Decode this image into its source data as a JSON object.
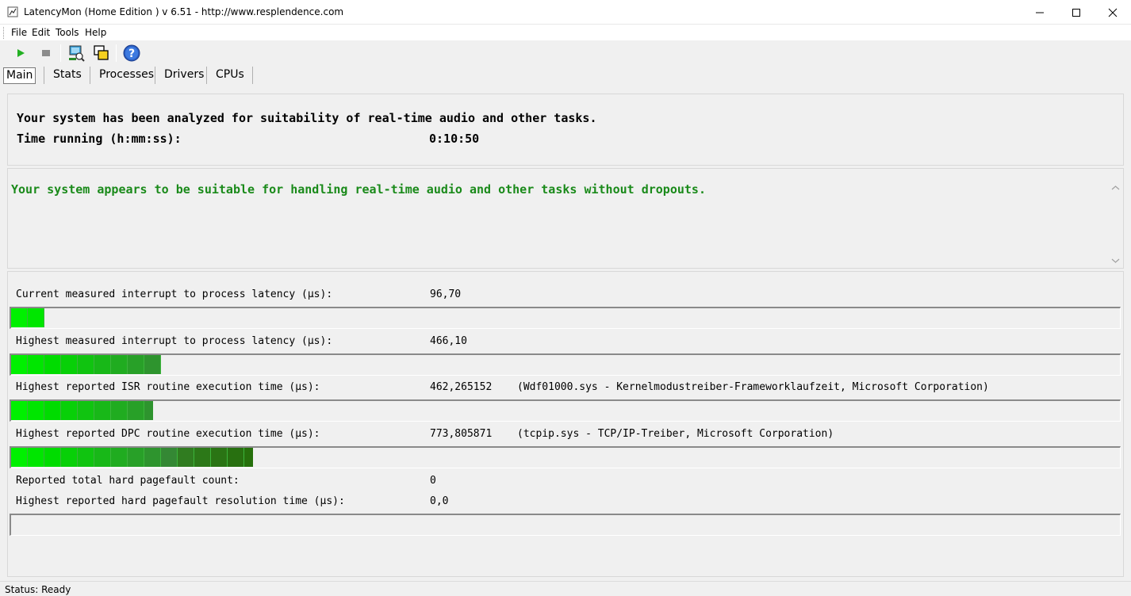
{
  "window": {
    "title": "LatencyMon  (Home Edition )  v 6.51 - http://www.resplendence.com",
    "controls": [
      "minimize-icon",
      "maximize-icon",
      "close-icon"
    ]
  },
  "menu": {
    "items": [
      "File",
      "Edit",
      "Tools",
      "Help"
    ]
  },
  "toolbar": {
    "buttons": [
      "play-icon",
      "stop-icon",
      "monitor-icon",
      "windows-icon",
      "help-icon"
    ]
  },
  "tabs": [
    "Main",
    "Stats",
    "Processes",
    "Drivers",
    "CPUs"
  ],
  "summary": {
    "analyzed": "Your system has been analyzed for suitability of real-time audio and other tasks.",
    "time_label": "Time running (h:mm:ss):",
    "time_value": "0:10:50"
  },
  "verdict": {
    "text": "Your system appears to be suitable for handling real-time audio and other tasks without dropouts.",
    "color": "#1a8a1a"
  },
  "metrics": [
    {
      "label": "Current measured interrupt to process latency (µs):",
      "value": "96,70",
      "extra": "",
      "bar_segments": 2
    },
    {
      "label": "Highest measured interrupt to process latency (µs):",
      "value": "466,10",
      "extra": "",
      "bar_segments": 9
    },
    {
      "label": "Highest reported ISR routine execution time (µs):",
      "value": "462,265152",
      "extra": "(Wdf01000.sys - Kernelmodustreiber-Frameworklaufzeit, Microsoft Corporation)",
      "bar_segments": 8.5
    },
    {
      "label": "Highest reported DPC routine execution time (µs):",
      "value": "773,805871",
      "extra": "(tcpip.sys - TCP/IP-Treiber, Microsoft Corporation)",
      "bar_segments": 14.5
    },
    {
      "label": "Reported total hard pagefault count:",
      "value": "0",
      "extra": ""
    },
    {
      "label": "Highest reported hard pagefault resolution time (µs):",
      "value": "0,0",
      "extra": "",
      "bar_segments": 0
    }
  ],
  "status": "Status: Ready"
}
